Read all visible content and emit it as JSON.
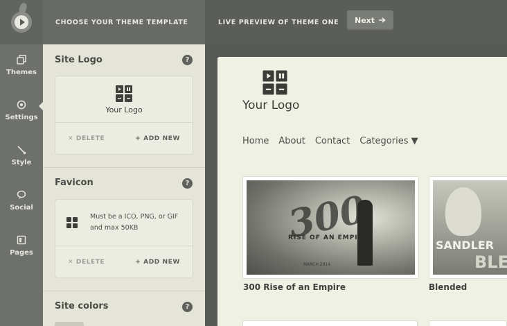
{
  "header": {
    "step1_label": "CHOOSE YOUR THEME TEMPLATE",
    "step2_label": "LIVE PREVIEW OF THEME ONE",
    "next_label": "Next",
    "next_icon": "arrow-right-icon"
  },
  "nav": {
    "items": [
      {
        "label": "Themes",
        "icon": "themes-icon"
      },
      {
        "label": "Settings",
        "icon": "settings-icon"
      },
      {
        "label": "Style",
        "icon": "style-brush-icon"
      },
      {
        "label": "Social",
        "icon": "social-bubble-icon"
      },
      {
        "label": "Pages",
        "icon": "pages-icon"
      }
    ],
    "active": "Style"
  },
  "panel": {
    "site_logo": {
      "title": "Site Logo",
      "logo_text": "Your Logo",
      "delete_label": "DELETE",
      "add_label": "ADD NEW"
    },
    "favicon": {
      "title": "Favicon",
      "hint": "Must be a ICO, PNG, or GIF and max 50KB",
      "delete_label": "DELETE",
      "add_label": "ADD NEW"
    },
    "site_colors": {
      "title": "Site colors"
    }
  },
  "preview": {
    "logo_text": "Your Logo",
    "nav": [
      "Home",
      "About",
      "Contact",
      "Categories ▼"
    ],
    "tiles": [
      {
        "title": "300 Rise of an Empire",
        "poster_text": "300",
        "poster_sub": "RISE OF AN EMPIRE",
        "poster_date": "MARCH 2014"
      },
      {
        "title": "Blended",
        "poster_text": "SANDLER",
        "poster_sub": "BLE"
      }
    ]
  },
  "colors": {
    "topbar": "#5b5d59",
    "nav": "#6e706c",
    "panel": "#e4e5d8",
    "preview": "#f0f1e5"
  }
}
